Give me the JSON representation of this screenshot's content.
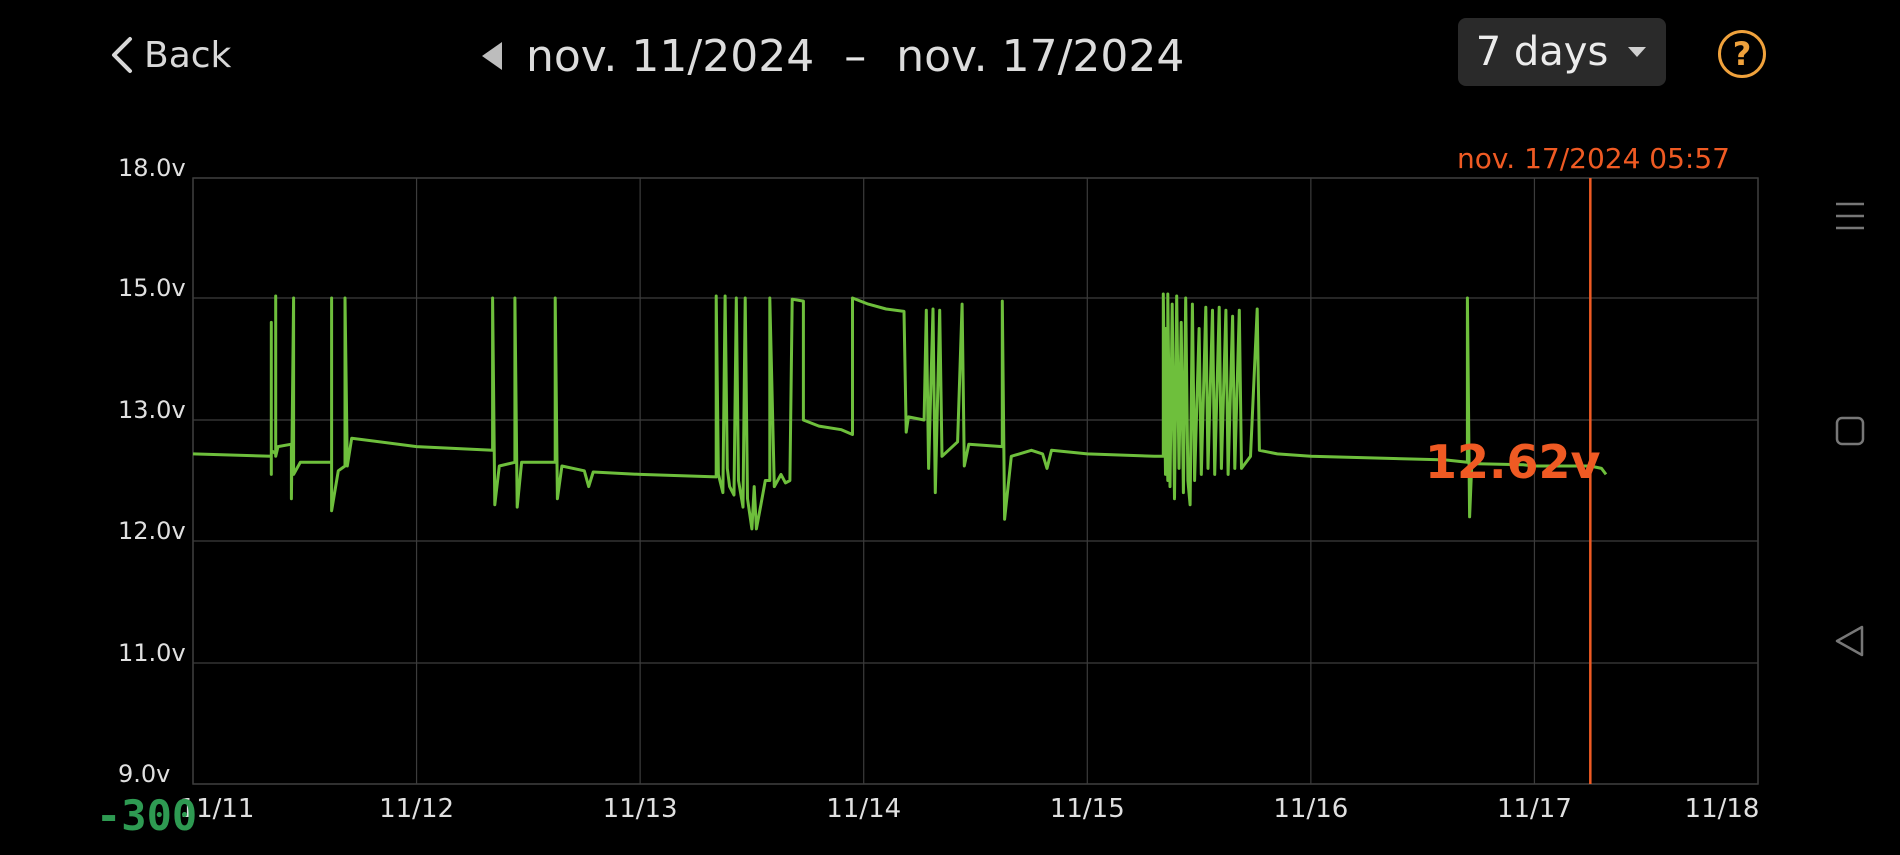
{
  "header": {
    "back_label": "Back",
    "date_from": "nov. 11/2024",
    "date_separator": "–",
    "date_to": "nov. 17/2024",
    "period": "7 days",
    "help": "?"
  },
  "cursor": {
    "timestamp": "nov. 17/2024 05:57",
    "value_label": "12.62v",
    "x_day": 6.25
  },
  "corner_label": "-300",
  "colors": {
    "line": "#6ebf3c",
    "cursor": "#ef5a23",
    "help": "#f0a23c",
    "corner": "#2e9a52",
    "grid": "#3c3c3c"
  },
  "icons": {
    "back": "chevron-left-icon",
    "prev": "triangle-left-icon",
    "dropdown": "caret-down-icon",
    "help": "question-circle-icon",
    "menu": "menu-lines-icon",
    "home": "square-icon",
    "nav_back": "triangle-back-icon"
  },
  "chart_data": {
    "type": "line",
    "ylim": [
      9,
      18
    ],
    "xlim": [
      0,
      7
    ],
    "y_ticks": [
      {
        "value": 18,
        "label": "18.0v"
      },
      {
        "value": 15,
        "label": "15.0v"
      },
      {
        "value": 13,
        "label": "13.0v"
      },
      {
        "value": 12,
        "label": "12.0v"
      },
      {
        "value": 11,
        "label": "11.0v"
      },
      {
        "value": 9,
        "label": "9.0v"
      }
    ],
    "x_ticks": [
      {
        "value": 0,
        "label": "11/11"
      },
      {
        "value": 1,
        "label": "11/12"
      },
      {
        "value": 2,
        "label": "11/13"
      },
      {
        "value": 3,
        "label": "11/14"
      },
      {
        "value": 4,
        "label": "11/15"
      },
      {
        "value": 5,
        "label": "11/16"
      },
      {
        "value": 6,
        "label": "11/17"
      },
      {
        "value": 7,
        "label": "11/18"
      }
    ],
    "series": [
      {
        "points": [
          [
            0.0,
            12.72
          ],
          [
            0.35,
            12.7
          ],
          [
            0.35,
            12.55
          ],
          [
            0.35,
            14.6
          ],
          [
            0.35,
            12.75
          ],
          [
            0.37,
            12.72
          ],
          [
            0.37,
            15.05
          ],
          [
            0.37,
            12.7
          ],
          [
            0.38,
            12.78
          ],
          [
            0.44,
            12.8
          ],
          [
            0.44,
            12.35
          ],
          [
            0.45,
            15.0
          ],
          [
            0.45,
            12.55
          ],
          [
            0.48,
            12.65
          ],
          [
            0.62,
            12.65
          ],
          [
            0.62,
            15.0
          ],
          [
            0.62,
            12.25
          ],
          [
            0.65,
            12.58
          ],
          [
            0.68,
            12.62
          ],
          [
            0.68,
            15.0
          ],
          [
            0.69,
            12.62
          ],
          [
            0.71,
            12.85
          ],
          [
            1.0,
            12.78
          ],
          [
            1.34,
            12.75
          ],
          [
            1.34,
            15.0
          ],
          [
            1.35,
            12.3
          ],
          [
            1.37,
            12.62
          ],
          [
            1.44,
            12.65
          ],
          [
            1.44,
            15.0
          ],
          [
            1.45,
            12.28
          ],
          [
            1.47,
            12.65
          ],
          [
            1.62,
            12.65
          ],
          [
            1.62,
            15.0
          ],
          [
            1.63,
            12.35
          ],
          [
            1.65,
            12.62
          ],
          [
            1.75,
            12.58
          ],
          [
            1.77,
            12.45
          ],
          [
            1.79,
            12.57
          ],
          [
            2.0,
            12.55
          ],
          [
            2.34,
            12.53
          ],
          [
            2.34,
            15.05
          ],
          [
            2.35,
            12.55
          ],
          [
            2.37,
            12.4
          ],
          [
            2.38,
            15.05
          ],
          [
            2.39,
            12.6
          ],
          [
            2.4,
            12.45
          ],
          [
            2.42,
            12.38
          ],
          [
            2.43,
            15.0
          ],
          [
            2.44,
            12.5
          ],
          [
            2.46,
            12.28
          ],
          [
            2.47,
            15.0
          ],
          [
            2.48,
            12.35
          ],
          [
            2.5,
            12.1
          ],
          [
            2.51,
            12.45
          ],
          [
            2.52,
            12.1
          ],
          [
            2.54,
            12.3
          ],
          [
            2.56,
            12.5
          ],
          [
            2.58,
            12.5
          ],
          [
            2.58,
            15.0
          ],
          [
            2.6,
            12.45
          ],
          [
            2.63,
            12.55
          ],
          [
            2.65,
            12.48
          ],
          [
            2.67,
            12.5
          ],
          [
            2.68,
            14.98
          ],
          [
            2.73,
            14.95
          ],
          [
            2.73,
            13.0
          ],
          [
            2.8,
            12.95
          ],
          [
            2.9,
            12.92
          ],
          [
            2.95,
            12.88
          ],
          [
            2.95,
            15.0
          ],
          [
            3.02,
            14.9
          ],
          [
            3.1,
            14.82
          ],
          [
            3.18,
            14.78
          ],
          [
            3.19,
            12.9
          ],
          [
            3.2,
            13.05
          ],
          [
            3.27,
            13.0
          ],
          [
            3.28,
            14.8
          ],
          [
            3.29,
            12.6
          ],
          [
            3.31,
            14.82
          ],
          [
            3.32,
            12.4
          ],
          [
            3.34,
            14.8
          ],
          [
            3.35,
            12.7
          ],
          [
            3.42,
            12.82
          ],
          [
            3.44,
            14.9
          ],
          [
            3.45,
            12.62
          ],
          [
            3.47,
            12.8
          ],
          [
            3.62,
            12.78
          ],
          [
            3.62,
            14.95
          ],
          [
            3.63,
            12.18
          ],
          [
            3.66,
            12.7
          ],
          [
            3.75,
            12.75
          ],
          [
            3.8,
            12.72
          ],
          [
            3.82,
            12.6
          ],
          [
            3.84,
            12.75
          ],
          [
            4.0,
            12.72
          ],
          [
            4.3,
            12.7
          ],
          [
            4.34,
            12.7
          ],
          [
            4.34,
            15.1
          ],
          [
            4.35,
            12.55
          ],
          [
            4.35,
            14.5
          ],
          [
            4.36,
            12.5
          ],
          [
            4.36,
            15.1
          ],
          [
            4.37,
            12.45
          ],
          [
            4.38,
            14.9
          ],
          [
            4.39,
            12.35
          ],
          [
            4.4,
            15.05
          ],
          [
            4.41,
            12.6
          ],
          [
            4.42,
            14.6
          ],
          [
            4.43,
            12.4
          ],
          [
            4.44,
            15.0
          ],
          [
            4.45,
            12.5
          ],
          [
            4.46,
            12.3
          ],
          [
            4.47,
            14.9
          ],
          [
            4.48,
            12.5
          ],
          [
            4.5,
            14.5
          ],
          [
            4.51,
            12.55
          ],
          [
            4.53,
            14.85
          ],
          [
            4.54,
            12.6
          ],
          [
            4.56,
            14.8
          ],
          [
            4.57,
            12.55
          ],
          [
            4.59,
            14.85
          ],
          [
            4.6,
            12.6
          ],
          [
            4.62,
            14.8
          ],
          [
            4.63,
            12.55
          ],
          [
            4.65,
            14.7
          ],
          [
            4.66,
            12.6
          ],
          [
            4.68,
            14.8
          ],
          [
            4.69,
            12.6
          ],
          [
            4.73,
            12.7
          ],
          [
            4.76,
            14.82
          ],
          [
            4.77,
            12.75
          ],
          [
            4.85,
            12.72
          ],
          [
            5.0,
            12.7
          ],
          [
            5.6,
            12.67
          ],
          [
            5.7,
            12.65
          ],
          [
            5.7,
            15.0
          ],
          [
            5.71,
            12.2
          ],
          [
            5.72,
            12.64
          ],
          [
            5.95,
            12.63
          ],
          [
            6.0,
            12.62
          ],
          [
            6.15,
            12.62
          ],
          [
            6.25,
            12.62
          ],
          [
            6.3,
            12.6
          ],
          [
            6.32,
            12.55
          ]
        ]
      }
    ]
  }
}
